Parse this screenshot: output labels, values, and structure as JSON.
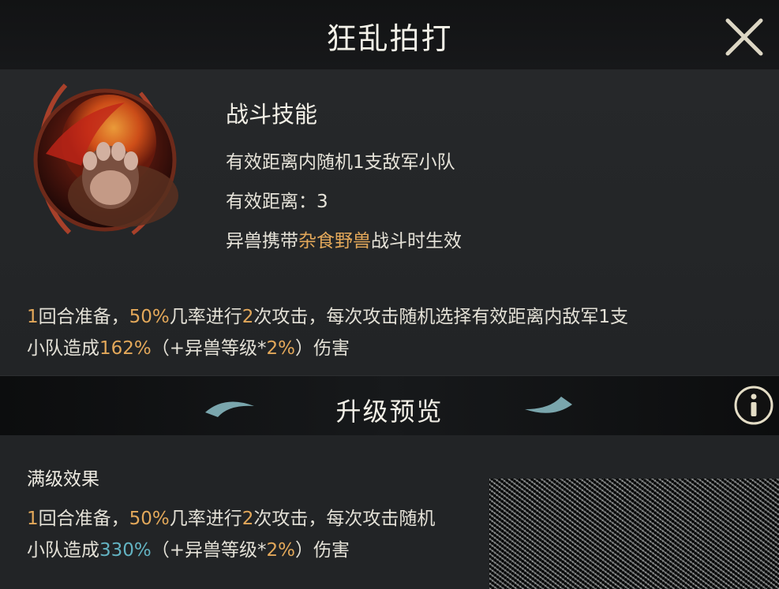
{
  "header": {
    "title": "狂乱拍打"
  },
  "skill": {
    "type": "战斗技能",
    "target": "有效距离内随机1支敌军小队",
    "range_label": "有效距离：",
    "range_value": "3",
    "condition_prefix": "异兽携带",
    "condition_highlight": "杂食野兽",
    "condition_suffix": "战斗时生效"
  },
  "description": {
    "prep_rounds": "1",
    "t1": "回合准备，",
    "chance": "50%",
    "t2": "几率进行",
    "attacks": "2",
    "t3": "次攻击，每次攻击随机选择有效距离内敌军1支",
    "t4": "小队造成",
    "damage": "162%",
    "t5": "（+异兽等级*",
    "per_level": "2%",
    "t6": "）伤害"
  },
  "upgrade": {
    "section_title": "升级预览",
    "max_label": "满级效果"
  },
  "max_description": {
    "prep_rounds": "1",
    "t1": "回合准备，",
    "chance": "50%",
    "t2": "几率进行",
    "attacks": "2",
    "t3": "次攻击，每次攻击随机",
    "t4": "小队造成",
    "damage": "330%",
    "t5": "（+异兽等级*",
    "per_level": "2%",
    "t6": "）伤害"
  },
  "icons": {
    "close": "close-icon",
    "skill": "beast-paw-icon",
    "info": "info-icon",
    "ornaments": "leaf-ornament-icon"
  },
  "colors": {
    "highlight": "#e3a85a",
    "upgrade_highlight": "#63b3c2",
    "text": "#e9e6dc"
  }
}
